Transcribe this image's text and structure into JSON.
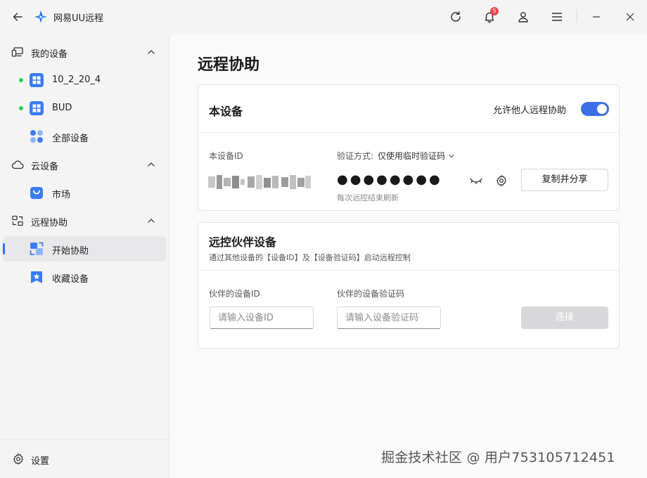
{
  "app": {
    "title": "网易UU远程"
  },
  "titlebar": {
    "notification_count": "5"
  },
  "sidebar": {
    "groups": [
      {
        "label": "我的设备"
      },
      {
        "label": "云设备"
      },
      {
        "label": "远程协助"
      }
    ],
    "items": [
      {
        "label": "10_2_20_4",
        "online": true
      },
      {
        "label": "BUD",
        "online": true
      },
      {
        "label": "全部设备"
      },
      {
        "label": "市场"
      },
      {
        "label": "开始协助",
        "active": true
      },
      {
        "label": "收藏设备"
      }
    ],
    "settings_label": "设置"
  },
  "main": {
    "title": "远程协助",
    "this_device": {
      "title": "本设备",
      "allow_label": "允许他人远程协助",
      "allow_enabled": true,
      "device_id_label": "本设备ID",
      "method_label": "验证方式:",
      "method_value": "仅使用临时验证码",
      "password_masked": "●●●●●●●●",
      "refresh_note": "每次远控结束刷新",
      "copy_share_label": "复制并分享"
    },
    "partner": {
      "title": "远控伙伴设备",
      "subtitle": "通过其他设备的【设备ID】及【设备验证码】启动远程控制",
      "id_label": "伙伴的设备ID",
      "id_placeholder": "请输入设备ID",
      "code_label": "伙伴的设备验证码",
      "code_placeholder": "请输入设备验证码",
      "connect_label": "连接"
    }
  },
  "watermark": "掘金技术社区 @ 用户753105712451",
  "colors": {
    "accent": "#3b6fe8",
    "online": "#2ecc55",
    "badge": "#f5434f"
  }
}
